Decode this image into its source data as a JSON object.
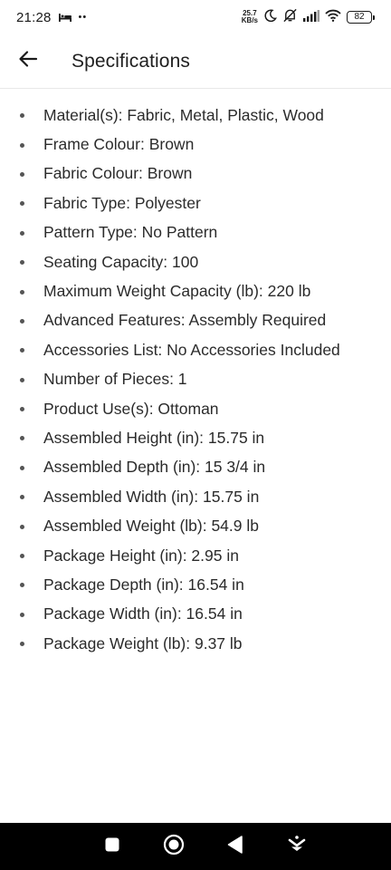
{
  "status_bar": {
    "time": "21:28",
    "extra": "••",
    "net_speed_value": "25.7",
    "net_speed_unit": "KB/s",
    "battery": "82",
    "icons": [
      "bed-icon",
      "moon-icon",
      "mute-icon",
      "signal-icon",
      "wifi-icon",
      "battery-icon"
    ]
  },
  "app_bar": {
    "back_icon": "arrow-left-icon",
    "title": "Specifications"
  },
  "specs": [
    "Material(s): Fabric, Metal, Plastic, Wood",
    "Frame Colour: Brown",
    "Fabric Colour: Brown",
    "Fabric Type: Polyester",
    "Pattern Type: No Pattern",
    "Seating Capacity: 100",
    "Maximum Weight Capacity (lb): 220 lb",
    "Advanced Features: Assembly Required",
    "Accessories List: No Accessories Included",
    "Number of Pieces: 1",
    "Product Use(s): Ottoman",
    "Assembled Height (in): 15.75 in",
    "Assembled Depth (in): 15 3/4 in",
    "Assembled Width (in): 15.75 in",
    "Assembled Weight (lb): 54.9 lb",
    "Package Height (in): 2.95 in",
    "Package Depth (in): 16.54 in",
    "Package Width (in): 16.54 in",
    "Package Weight (lb): 9.37 lb"
  ],
  "nav_bar": {
    "buttons": [
      "square-icon",
      "circle-icon",
      "back-triangle-icon",
      "assistant-icon"
    ]
  }
}
